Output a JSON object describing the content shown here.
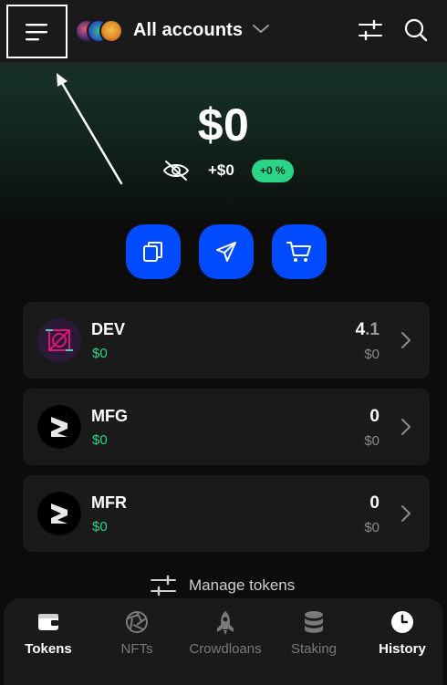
{
  "header": {
    "account_title": "All accounts",
    "icons": [
      "menu-icon",
      "chevron-down-icon",
      "sliders-icon",
      "search-icon"
    ]
  },
  "balance": {
    "total": "$0",
    "change_amount": "+$0",
    "change_percent": "+0 %"
  },
  "actions": [
    {
      "name": "copy-address-button",
      "icon": "copy-icon"
    },
    {
      "name": "send-button",
      "icon": "send-icon"
    },
    {
      "name": "buy-button",
      "icon": "cart-icon"
    }
  ],
  "tokens": [
    {
      "symbol": "DEV",
      "value": "$0",
      "balance_int": "4",
      "balance_dec": ".1",
      "balance_usd": "$0"
    },
    {
      "symbol": "MFG",
      "value": "$0",
      "balance_int": "0",
      "balance_dec": "",
      "balance_usd": "$0"
    },
    {
      "symbol": "MFR",
      "value": "$0",
      "balance_int": "0",
      "balance_dec": "",
      "balance_usd": "$0"
    }
  ],
  "manage_tokens_label": "Manage tokens",
  "bottom_nav": [
    {
      "label": "Tokens",
      "icon": "wallet-icon",
      "active": true
    },
    {
      "label": "NFTs",
      "icon": "aperture-icon",
      "active": false
    },
    {
      "label": "Crowdloans",
      "icon": "rocket-icon",
      "active": false
    },
    {
      "label": "Staking",
      "icon": "database-icon",
      "active": false
    },
    {
      "label": "History",
      "icon": "clock-icon",
      "active": true
    }
  ],
  "colors": {
    "accent_blue": "#004bff",
    "positive_green": "#2bd487",
    "card_bg": "#1a1a1a"
  }
}
